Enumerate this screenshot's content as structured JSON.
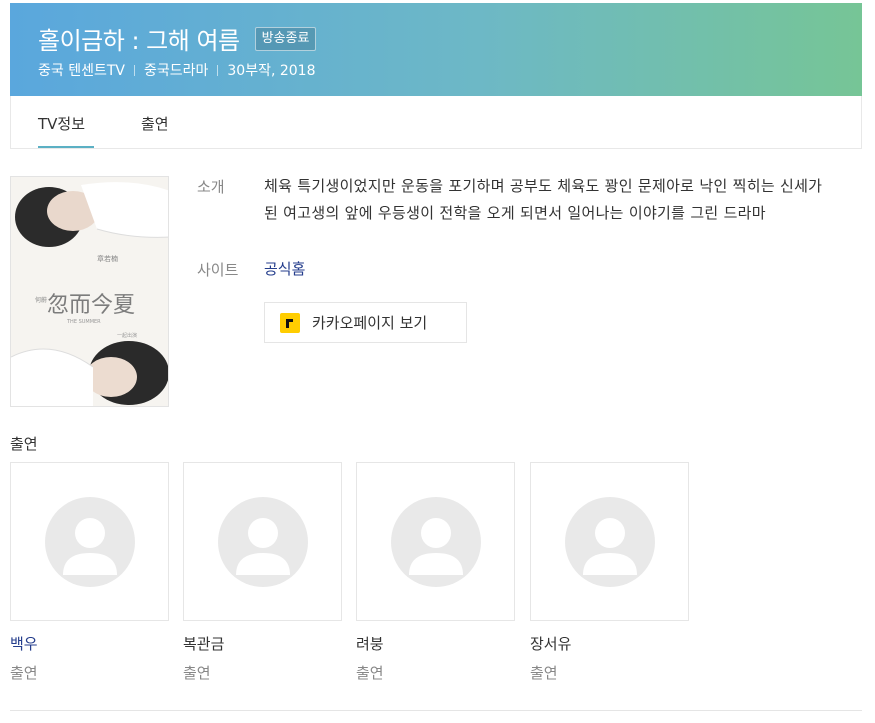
{
  "header": {
    "title": "홀이금하 : 그해 여름",
    "status": "방송종료",
    "meta": [
      "중국 텐센트TV",
      "중국드라마",
      "30부작, 2018"
    ]
  },
  "tabs": [
    {
      "label": "TV정보",
      "active": true
    },
    {
      "label": "출연",
      "active": false
    }
  ],
  "poster": {
    "title_text": "忽而今夏",
    "subtitle_text": "THE SUMMER",
    "top_caption": "章若楠",
    "side_caption": "何蔚",
    "right_caption": "一起出演"
  },
  "info": {
    "intro_label": "소개",
    "intro_text": "체육 특기생이었지만 운동을 포기하며 공부도 체육도 꽝인 문제아로 낙인 찍히는 신세가 된 여고생의 앞에 우등생이 전학을 오게 되면서 일어나는 이야기를 그린 드라마",
    "site_label": "사이트",
    "site_link": "공식홈",
    "kakao_button": "카카오페이지 보기"
  },
  "cast_section": {
    "title": "출연",
    "members": [
      {
        "name": "백우",
        "role": "출연",
        "linked": true
      },
      {
        "name": "복관금",
        "role": "출연",
        "linked": false
      },
      {
        "name": "려붕",
        "role": "출연",
        "linked": false
      },
      {
        "name": "장서유",
        "role": "출연",
        "linked": false
      }
    ]
  },
  "colors": {
    "header_gradient_start": "#5aa7dd",
    "header_gradient_end": "#76c596",
    "tab_underline": "#5bb0c4",
    "link": "#243d8c",
    "kakao_yellow": "#ffcd00"
  }
}
